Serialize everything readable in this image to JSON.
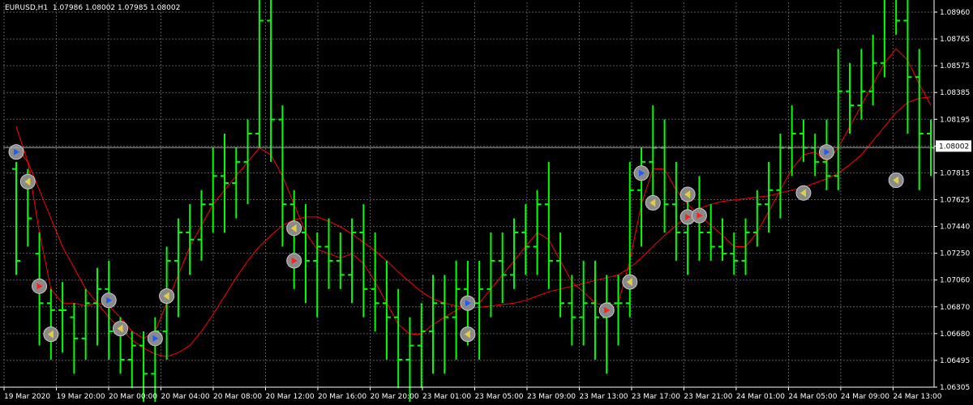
{
  "header": {
    "symbol": "EURUSD,H1",
    "ohlc": "1.07986 1.08002 1.07985 1.08002"
  },
  "colors": {
    "background": "#000000",
    "grid": "#5a5a5a",
    "bars": "#00ff00",
    "ma": "#ff0000",
    "current_price_line": "#aaaaaa",
    "text": "#ffffff"
  },
  "chart_data": {
    "type": "ohlc",
    "symbol": "EURUSD",
    "timeframe": "H1",
    "grid": true,
    "current_price": 1.08002,
    "ylim": [
      1.06305,
      1.0896
    ],
    "y_ticks": [
      "1.08960",
      "1.08765",
      "1.08575",
      "1.08385",
      "1.08195",
      "1.08002",
      "1.07815",
      "1.07625",
      "1.07440",
      "1.07250",
      "1.07060",
      "1.06870",
      "1.06680",
      "1.06495",
      "1.06305"
    ],
    "x_ticks": [
      "19 Mar 2020",
      "19 Mar 20:00",
      "20 Mar 00:00",
      "20 Mar 04:00",
      "20 Mar 08:00",
      "20 Mar 12:00",
      "20 Mar 16:00",
      "20 Mar 20:00",
      "23 Mar 01:00",
      "23 Mar 05:00",
      "23 Mar 09:00",
      "23 Mar 13:00",
      "23 Mar 17:00",
      "23 Mar 21:00",
      "24 Mar 01:00",
      "24 Mar 05:00",
      "24 Mar 09:00",
      "24 Mar 13:00"
    ],
    "bars": [
      [
        1.0785,
        1.079,
        1.071,
        1.072
      ],
      [
        1.078,
        1.0785,
        1.073,
        1.075
      ],
      [
        1.0725,
        1.074,
        1.066,
        1.069
      ],
      [
        1.069,
        1.07,
        1.065,
        1.0685
      ],
      [
        1.0685,
        1.0705,
        1.0655,
        1.0685
      ],
      [
        1.068,
        1.069,
        1.064,
        1.0665
      ],
      [
        1.0665,
        1.07,
        1.065,
        1.069
      ],
      [
        1.069,
        1.0715,
        1.066,
        1.07
      ],
      [
        1.07,
        1.072,
        1.065,
        1.067
      ],
      [
        1.067,
        1.068,
        1.064,
        1.065
      ],
      [
        1.065,
        1.067,
        1.063,
        1.066
      ],
      [
        1.066,
        1.067,
        1.062,
        1.064
      ],
      [
        1.064,
        1.068,
        1.062,
        1.067
      ],
      [
        1.067,
        1.073,
        1.065,
        1.072
      ],
      [
        1.072,
        1.075,
        1.068,
        1.074
      ],
      [
        1.074,
        1.076,
        1.071,
        1.0735
      ],
      [
        1.0735,
        1.077,
        1.072,
        1.076
      ],
      [
        1.076,
        1.08,
        1.074,
        1.078
      ],
      [
        1.078,
        1.081,
        1.074,
        1.0775
      ],
      [
        1.0775,
        1.08,
        1.075,
        1.079
      ],
      [
        1.079,
        1.082,
        1.076,
        1.081
      ],
      [
        1.081,
        1.091,
        1.08,
        1.089
      ],
      [
        1.089,
        1.091,
        1.079,
        1.082
      ],
      [
        1.082,
        1.083,
        1.073,
        1.076
      ],
      [
        1.076,
        1.077,
        1.07,
        1.074
      ],
      [
        1.074,
        1.076,
        1.069,
        1.072
      ],
      [
        1.072,
        1.074,
        1.068,
        1.073
      ],
      [
        1.073,
        1.075,
        1.07,
        1.072
      ],
      [
        1.072,
        1.074,
        1.07,
        1.071
      ],
      [
        1.071,
        1.075,
        1.069,
        1.074
      ],
      [
        1.074,
        1.076,
        1.068,
        1.07
      ],
      [
        1.07,
        1.074,
        1.067,
        1.069
      ],
      [
        1.069,
        1.072,
        1.065,
        1.068
      ],
      [
        1.068,
        1.07,
        1.063,
        1.065
      ],
      [
        1.065,
        1.068,
        1.062,
        1.066
      ],
      [
        1.066,
        1.069,
        1.063,
        1.067
      ],
      [
        1.067,
        1.071,
        1.064,
        1.069
      ],
      [
        1.069,
        1.071,
        1.064,
        1.068
      ],
      [
        1.068,
        1.072,
        1.065,
        1.07
      ],
      [
        1.07,
        1.072,
        1.066,
        1.069
      ],
      [
        1.069,
        1.072,
        1.065,
        1.07
      ],
      [
        1.07,
        1.074,
        1.068,
        1.072
      ],
      [
        1.072,
        1.074,
        1.069,
        1.071
      ],
      [
        1.071,
        1.075,
        1.07,
        1.074
      ],
      [
        1.074,
        1.076,
        1.071,
        1.073
      ],
      [
        1.073,
        1.077,
        1.071,
        1.076
      ],
      [
        1.076,
        1.079,
        1.07,
        1.072
      ],
      [
        1.072,
        1.074,
        1.068,
        1.069
      ],
      [
        1.069,
        1.071,
        1.066,
        1.068
      ],
      [
        1.068,
        1.072,
        1.066,
        1.069
      ],
      [
        1.069,
        1.072,
        1.065,
        1.068
      ],
      [
        1.068,
        1.071,
        1.064,
        1.069
      ],
      [
        1.069,
        1.071,
        1.066,
        1.069
      ],
      [
        1.069,
        1.079,
        1.068,
        1.077
      ],
      [
        1.077,
        1.08,
        1.073,
        1.079
      ],
      [
        1.079,
        1.083,
        1.076,
        1.08
      ],
      [
        1.08,
        1.082,
        1.074,
        1.076
      ],
      [
        1.076,
        1.079,
        1.072,
        1.074
      ],
      [
        1.074,
        1.077,
        1.071,
        1.075
      ],
      [
        1.075,
        1.078,
        1.072,
        1.074
      ],
      [
        1.074,
        1.076,
        1.072,
        1.073
      ],
      [
        1.073,
        1.075,
        1.072,
        1.0725
      ],
      [
        1.0725,
        1.074,
        1.071,
        1.072
      ],
      [
        1.072,
        1.075,
        1.071,
        1.074
      ],
      [
        1.074,
        1.077,
        1.073,
        1.076
      ],
      [
        1.076,
        1.079,
        1.074,
        1.077
      ],
      [
        1.077,
        1.081,
        1.075,
        1.08
      ],
      [
        1.08,
        1.083,
        1.078,
        1.081
      ],
      [
        1.081,
        1.082,
        1.079,
        1.08
      ],
      [
        1.08,
        1.081,
        1.078,
        1.079
      ],
      [
        1.079,
        1.082,
        1.077,
        1.078
      ],
      [
        1.078,
        1.087,
        1.077,
        1.084
      ],
      [
        1.084,
        1.086,
        1.081,
        1.083
      ],
      [
        1.083,
        1.087,
        1.082,
        1.084
      ],
      [
        1.084,
        1.088,
        1.083,
        1.086
      ],
      [
        1.086,
        1.094,
        1.085,
        1.092
      ],
      [
        1.092,
        1.094,
        1.088,
        1.089
      ],
      [
        1.089,
        1.091,
        1.081,
        1.085
      ],
      [
        1.085,
        1.087,
        1.077,
        1.081
      ],
      [
        1.081,
        1.082,
        1.078,
        1.08
      ]
    ],
    "ma_fast": [
      1.0815,
      1.079,
      1.074,
      1.07,
      1.069,
      1.069,
      1.0688,
      1.069,
      1.0688,
      1.068,
      1.067,
      1.0665,
      1.067,
      1.069,
      1.071,
      1.073,
      1.0745,
      1.076,
      1.077,
      1.078,
      1.079,
      1.08,
      1.0795,
      1.078,
      1.076,
      1.074,
      1.0728,
      1.0725,
      1.0722,
      1.0725,
      1.0718,
      1.0705,
      1.069,
      1.0675,
      1.0668,
      1.0668,
      1.0675,
      1.068,
      1.0685,
      1.069,
      1.069,
      1.07,
      1.071,
      1.072,
      1.073,
      1.074,
      1.0735,
      1.072,
      1.0705,
      1.0698,
      1.069,
      1.0688,
      1.069,
      1.072,
      1.076,
      1.0785,
      1.0785,
      1.077,
      1.076,
      1.0752,
      1.0745,
      1.0738,
      1.073,
      1.073,
      1.074,
      1.0755,
      1.077,
      1.0785,
      1.0795,
      1.0797,
      1.079,
      1.08,
      1.0815,
      1.083,
      1.0845,
      1.086,
      1.087,
      1.0862,
      1.0845,
      1.083
    ],
    "ma_slow": [
      1.08,
      1.079,
      1.077,
      1.075,
      1.073,
      1.0715,
      1.07,
      1.069,
      1.068,
      1.0672,
      1.0664,
      1.0658,
      1.0654,
      1.0652,
      1.0655,
      1.066,
      1.067,
      1.0682,
      1.0695,
      1.0708,
      1.072,
      1.073,
      1.0738,
      1.0745,
      1.0749,
      1.0751,
      1.0751,
      1.0748,
      1.0744,
      1.0739,
      1.0733,
      1.0727,
      1.072,
      1.0712,
      1.0705,
      1.0698,
      1.0693,
      1.069,
      1.0688,
      1.0687,
      1.0687,
      1.0688,
      1.0689,
      1.069,
      1.0692,
      1.0695,
      1.0698,
      1.07,
      1.0702,
      1.0704,
      1.0706,
      1.0708,
      1.071,
      1.0715,
      1.0722,
      1.073,
      1.0738,
      1.0745,
      1.0752,
      1.0757,
      1.076,
      1.0762,
      1.0763,
      1.0764,
      1.0765,
      1.0766,
      1.0768,
      1.077,
      1.0772,
      1.0775,
      1.0778,
      1.0782,
      1.0788,
      1.0795,
      1.0805,
      1.0815,
      1.0825,
      1.0832,
      1.0835,
      1.0836
    ],
    "signals": [
      {
        "bar": 0,
        "price": 1.0797,
        "type": "buy"
      },
      {
        "bar": 1,
        "price": 1.0776,
        "type": "close"
      },
      {
        "bar": 2,
        "price": 1.0702,
        "type": "sell"
      },
      {
        "bar": 3,
        "price": 1.0668,
        "type": "close"
      },
      {
        "bar": 8,
        "price": 1.0692,
        "type": "buy"
      },
      {
        "bar": 9,
        "price": 1.0672,
        "type": "close"
      },
      {
        "bar": 12,
        "price": 1.0665,
        "type": "buy"
      },
      {
        "bar": 13,
        "price": 1.0695,
        "type": "close"
      },
      {
        "bar": 24,
        "price": 1.0743,
        "type": "close"
      },
      {
        "bar": 24,
        "price": 1.072,
        "type": "sell"
      },
      {
        "bar": 39,
        "price": 1.069,
        "type": "buy"
      },
      {
        "bar": 39,
        "price": 1.0668,
        "type": "close"
      },
      {
        "bar": 51,
        "price": 1.0685,
        "type": "sell"
      },
      {
        "bar": 53,
        "price": 1.0705,
        "type": "close"
      },
      {
        "bar": 54,
        "price": 1.0782,
        "type": "buy"
      },
      {
        "bar": 55,
        "price": 1.0761,
        "type": "close"
      },
      {
        "bar": 58,
        "price": 1.0767,
        "type": "close"
      },
      {
        "bar": 58,
        "price": 1.0751,
        "type": "sell"
      },
      {
        "bar": 59,
        "price": 1.0752,
        "type": "sell"
      },
      {
        "bar": 68,
        "price": 1.0768,
        "type": "close"
      },
      {
        "bar": 70,
        "price": 1.0797,
        "type": "buy"
      },
      {
        "bar": 76,
        "price": 1.0777,
        "type": "close"
      }
    ]
  }
}
